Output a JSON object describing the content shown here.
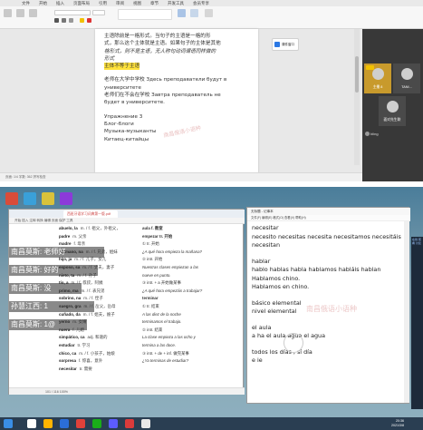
{
  "top": {
    "ribbon_tabs": [
      "文件",
      "开始",
      "插入",
      "页面布局",
      "引用",
      "审阅",
      "视图",
      "章节",
      "开发工具",
      "会员专享"
    ],
    "document_lines": [
      {
        "text": "主语除前是一格形式。当句子的主语是一格的形",
        "style": "normal"
      },
      {
        "text": "式，那么这个主体就是主语。如果句子的主体是其他",
        "style": "normal"
      },
      {
        "text": "格形式，则不是主语，无人称句动词谓语同样做的",
        "style": "ital"
      },
      {
        "text": "形式",
        "style": "ital"
      },
      {
        "text": "主体不等于主语",
        "style": "hl"
      },
      {
        "text": "",
        "style": "gap"
      },
      {
        "text": "老师在大学中学校 Здесь преподаватели будут в",
        "style": "normal"
      },
      {
        "text": "университете",
        "style": "normal"
      },
      {
        "text": "老师们在不会在学校 Завтра преподаватель не",
        "style": "normal"
      },
      {
        "text": "будет в университете.",
        "style": "normal"
      },
      {
        "text": "",
        "style": "gap"
      },
      {
        "text": "Упражнение 3",
        "style": "normal"
      },
      {
        "text": "Блог-блоги",
        "style": "normal"
      },
      {
        "text": "Музыка-музыканты",
        "style": "normal"
      },
      {
        "text": "Китаец-китайцы",
        "style": "normal"
      }
    ],
    "side_button": "课件窗口",
    "watermark": "南昌俄语小语种",
    "call_names": [
      "主播 8",
      "TANI...",
      "面对先生联"
    ],
    "call_chat": "bling",
    "status": "页面: 1/4  字数: 362  拼写检查"
  },
  "bottom": {
    "dict_title": "西班牙语学习词典第一版.pdf",
    "dict_tools": "开始 插入 注释 转换 编辑 页面 保护 工具",
    "dict_rows_left": [
      {
        "word": "abuelo, la",
        "def": "m. / f. 祖父，外祖父，"
      },
      {
        "word": "padre",
        "def": "m. 父亲"
      },
      {
        "word": "madre",
        "def": "f. 母亲"
      },
      {
        "word": "hermano, na",
        "def": "m. / f. 兄弟，姐妹"
      },
      {
        "word": "hijo, ja",
        "def": "m. / f. 儿子，女儿"
      },
      {
        "word": "esposo, sa",
        "def": "m. / f. 丈夫，妻子"
      },
      {
        "word": "nieto, ta",
        "def": "m. / f. 孙子"
      },
      {
        "word": "tío, a",
        "def": "m. / f. 叔叔，阿姨"
      },
      {
        "word": "primo, ma",
        "def": "m. / f. 表兄弟"
      },
      {
        "word": "sobrino, na",
        "def": "m. / f. 侄子"
      },
      {
        "word": "suegro, gra",
        "def": "m. / f. 岳父，岳母"
      },
      {
        "word": "cuñado, da",
        "def": "m. / f. 姐夫，嫂子"
      },
      {
        "word": "yerno",
        "def": "m. 女婿"
      },
      {
        "word": "nuera",
        "def": "f. 儿媳"
      },
      {
        "word": "simpático, ca",
        "def": "adj. 和蔼的"
      },
      {
        "word": "estudiar",
        "def": "tr. 学习"
      },
      {
        "word": "chico, ca",
        "def": "m. / f. 小孩子，姑娘"
      },
      {
        "word": "sorpresa",
        "def": "f. 惊喜，意外"
      },
      {
        "word": "necesitar",
        "def": "tr. 需要"
      }
    ],
    "dict_rows_right": [
      {
        "text": "aula   f. 教室",
        "style": "b"
      },
      {
        "text": "empezar   tr. 开始",
        "style": "b"
      },
      {
        "text": "① tr. 开始",
        "style": "n"
      },
      {
        "text": "¿A qué hora empieza la mañana?",
        "style": "it"
      },
      {
        "text": "② intr. 开始",
        "style": "n"
      },
      {
        "text": "Nuestras clases empiezan a las",
        "style": "it"
      },
      {
        "text": "nueve en punto.",
        "style": "it"
      },
      {
        "text": "③ intr. + a 开始做某事",
        "style": "n"
      },
      {
        "text": "¿A qué hora empezáis a trabajar?",
        "style": "it"
      },
      {
        "text": "terminar",
        "style": "b"
      },
      {
        "text": "① tr. 结束",
        "style": "n"
      },
      {
        "text": "A las diez de la noche",
        "style": "it"
      },
      {
        "text": "terminamos el trabajo.",
        "style": "it"
      },
      {
        "text": "② intr. 结束",
        "style": "n"
      },
      {
        "text": "La clase empieza a las ocho y",
        "style": "it"
      },
      {
        "text": "termina a las doce.",
        "style": "it"
      },
      {
        "text": "③ intr. + de + inf. 做完某事",
        "style": "n"
      },
      {
        "text": "¿Ya terminas de estudiar?",
        "style": "it"
      },
      {
        "text": "",
        "style": "n"
      }
    ],
    "dict_status": "101 / 116   100%",
    "bubbles": [
      "南昌莫斯: 老师好",
      "南昌莫斯: 好的",
      "南昌莫斯: 没",
      "孙慧江西: 1",
      "南昌莫斯: 1@"
    ],
    "note_title": "无标题 - 记事本",
    "note_menu": "文件(F) 编辑(E) 格式(O) 查看(V) 帮助(H)",
    "note_lines": [
      "necesitar",
      "necesito necesitas necesita necesitamos necesitáis",
      "necesitan",
      "",
      "hablar",
      "hablo hablas habla hablamos habláis hablan",
      "Hablamos chino.",
      "Hablamos en chino.",
      "",
      "básico elemental",
      "nivel elemental",
      "",
      "el aula",
      "a ha el aula agua el agua",
      "",
      "todos los días , sí día",
      "e ie"
    ],
    "watermark": "南昌俄语小语种",
    "live_text": "在线 观看 讨论",
    "clock_time": "20:36",
    "clock_date": "2021/3/8"
  }
}
